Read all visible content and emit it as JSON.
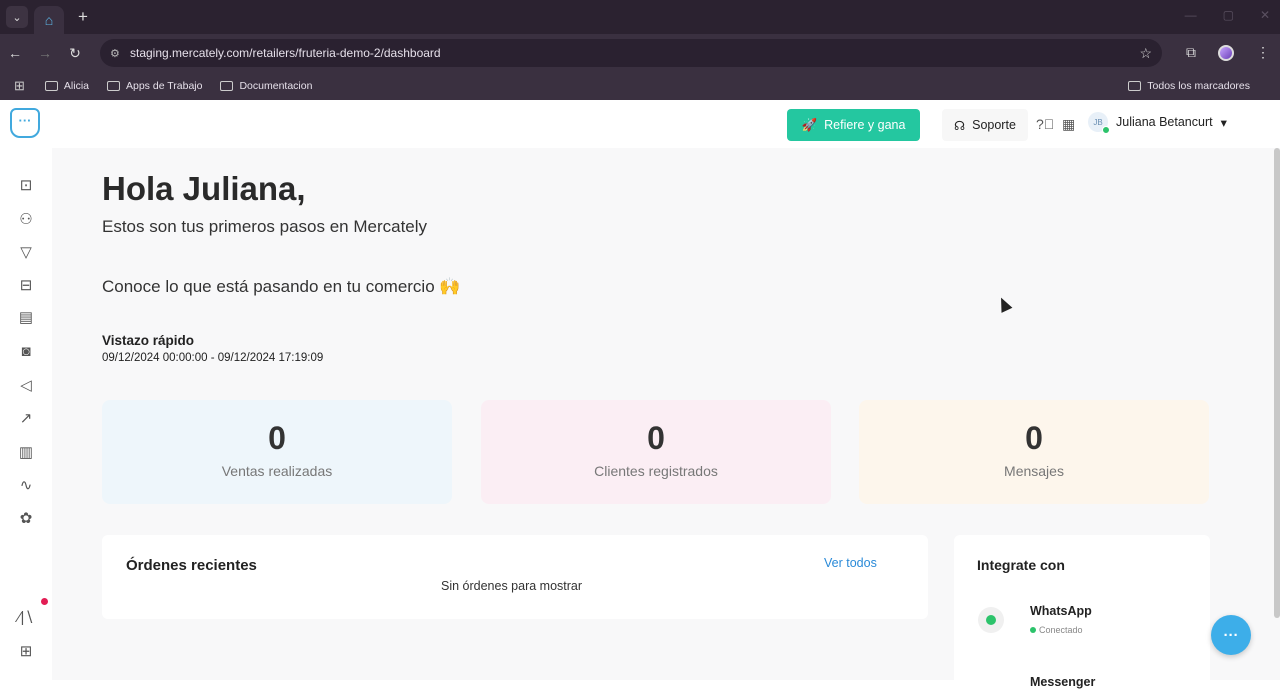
{
  "browser": {
    "url": "staging.mercately.com/retailers/fruteria-demo-2/dashboard",
    "bookmarks": [
      "Alicia",
      "Apps de Trabajo",
      "Documentacion"
    ],
    "all_bookmarks": "Todos los marcadores"
  },
  "topbar": {
    "refer_label": "Refiere y gana",
    "support_label": "Soporte",
    "user_initials": "JB",
    "user_name": "Juliana Betancurt"
  },
  "main": {
    "greeting": "Hola Juliana,",
    "subtitle": "Estos son tus primeros pasos en Mercately",
    "know": "Conoce lo que está pasando en tu comercio 🙌",
    "quick_title": "Vistazo rápido",
    "quick_range": "09/12/2024 00:00:00 - 09/12/2024 17:19:09"
  },
  "stats": [
    {
      "value": "0",
      "label": "Ventas realizadas",
      "color": "#eef6fb"
    },
    {
      "value": "0",
      "label": "Clientes registrados",
      "color": "#fbeef4"
    },
    {
      "value": "0",
      "label": "Mensajes",
      "color": "#fdf6ec"
    }
  ],
  "orders": {
    "title": "Órdenes recientes",
    "view_all": "Ver todos",
    "empty": "Sin órdenes para mostrar"
  },
  "integrations": {
    "title": "Integrate con",
    "items": [
      {
        "name": "WhatsApp",
        "status": "Conectado"
      },
      {
        "name": "Messenger",
        "status": ""
      }
    ]
  },
  "colors": {
    "brand": "#41a9de",
    "refer": "#24c7a0",
    "link": "#2a8ad8"
  }
}
